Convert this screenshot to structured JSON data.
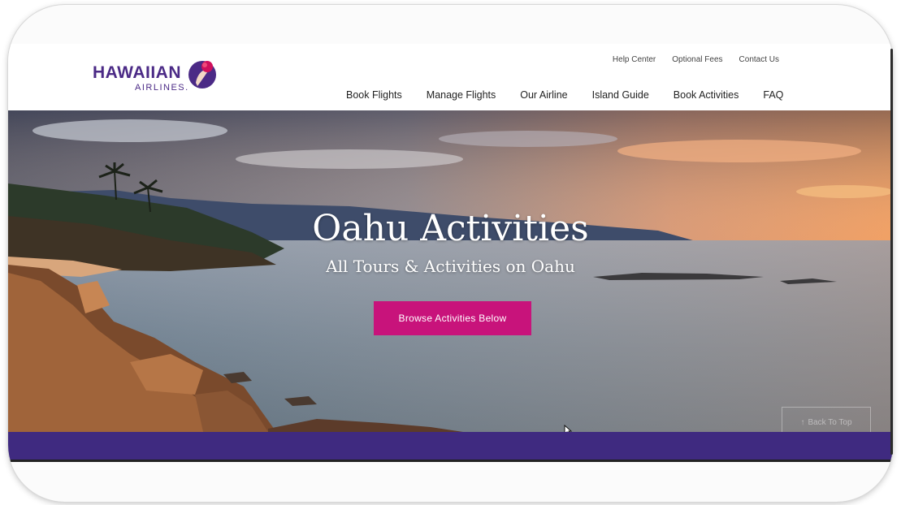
{
  "brand": {
    "name": "HAWAIIAN",
    "sub": "AIRLINES.",
    "primary_color": "#4b2a86",
    "accent_color": "#c8137b"
  },
  "utility_nav": [
    "Help Center",
    "Optional Fees",
    "Contact Us"
  ],
  "main_nav": [
    "Book Flights",
    "Manage Flights",
    "Our Airline",
    "Island Guide",
    "Book Activities",
    "FAQ"
  ],
  "hero": {
    "title": "Oahu Activities",
    "subtitle": "All Tours & Activities on Oahu",
    "cta_label": "Browse Activities Below"
  },
  "back_to_top": {
    "icon": "arrow-up-icon",
    "label": "Back To Top"
  }
}
